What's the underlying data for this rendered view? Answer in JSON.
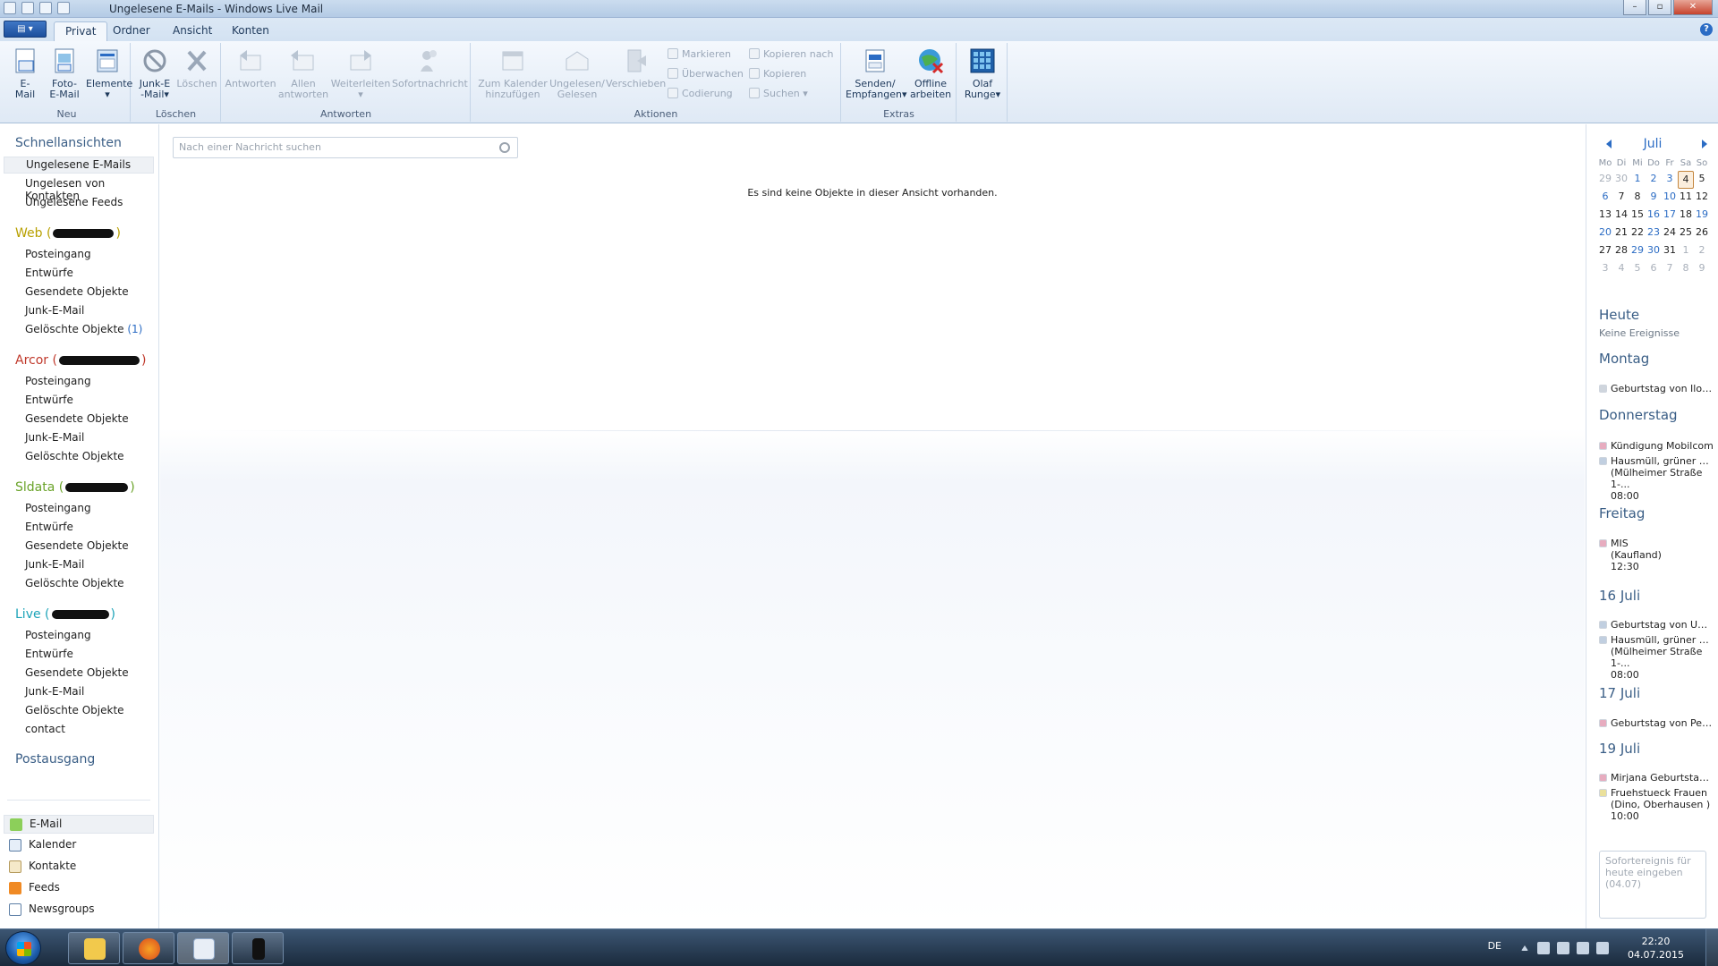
{
  "window": {
    "title": "Ungelesene E-Mails - Windows Live Mail"
  },
  "tabs": [
    "Privat",
    "Ordner",
    "Ansicht",
    "Konten"
  ],
  "ribbon": {
    "groups": {
      "neu": "Neu",
      "loeschen": "Löschen",
      "antworten": "Antworten",
      "aktionen": "Aktionen",
      "extras": "Extras"
    },
    "email": [
      "E-",
      "Mail"
    ],
    "foto_email": [
      "Foto-",
      "E-Mail"
    ],
    "elemente": "Elemente",
    "junk": [
      "Junk-E",
      "-Mail"
    ],
    "loeschen": "Löschen",
    "antworten": "Antworten",
    "allen_antworten": [
      "Allen",
      "antworten"
    ],
    "weiterleiten": "Weiterleiten",
    "sofortnachricht": "Sofortnachricht",
    "zum_kalender": [
      "Zum Kalender",
      "hinzufügen"
    ],
    "ungelesen": [
      "Ungelesen/",
      "Gelesen"
    ],
    "verschieben": "Verschieben",
    "markieren": "Markieren",
    "ueberwachen": "Überwachen",
    "codierung": "Codierung",
    "kopieren_nach": "Kopieren nach",
    "kopieren": "Kopieren",
    "suchen": "Suchen",
    "senden": [
      "Senden/",
      "Empfangen"
    ],
    "offline": [
      "Offline",
      "arbeiten"
    ],
    "user": [
      "Olaf",
      "Runge"
    ]
  },
  "sidebar": {
    "quickviews_title": "Schnellansichten",
    "quickviews": [
      "Ungelesene E-Mails",
      "Ungelesen von Kontakten",
      "Ungelesene Feeds"
    ],
    "accounts": [
      {
        "name": "Web",
        "color": "#b8a000",
        "folders": [
          "Posteingang",
          "Entwürfe",
          "Gesendete Objekte",
          "Junk-E-Mail",
          "Gelöschte Objekte"
        ],
        "deleted_count": "(1)"
      },
      {
        "name": "Arcor",
        "color": "#c0392b",
        "folders": [
          "Posteingang",
          "Entwürfe",
          "Gesendete Objekte",
          "Junk-E-Mail",
          "Gelöschte Objekte"
        ]
      },
      {
        "name": "Sldata",
        "color": "#6aa329",
        "folders": [
          "Posteingang",
          "Entwürfe",
          "Gesendete Objekte",
          "Junk-E-Mail",
          "Gelöschte Objekte"
        ]
      },
      {
        "name": "Live",
        "color": "#1ca3b8",
        "folders": [
          "Posteingang",
          "Entwürfe",
          "Gesendete Objekte",
          "Junk-E-Mail",
          "Gelöschte Objekte",
          "contact"
        ]
      }
    ],
    "outbox": "Postausgang",
    "nav": [
      "E-Mail",
      "Kalender",
      "Kontakte",
      "Feeds",
      "Newsgroups"
    ]
  },
  "main": {
    "search_placeholder": "Nach einer Nachricht suchen",
    "empty_message": "Es sind keine Objekte in dieser Ansicht vorhanden."
  },
  "calendar": {
    "month": "Juli",
    "weekdays": [
      "Mo",
      "Di",
      "Mi",
      "Do",
      "Fr",
      "Sa",
      "So"
    ],
    "weeks": [
      [
        "29",
        "30",
        "1",
        "2",
        "3",
        "4",
        "5"
      ],
      [
        "6",
        "7",
        "8",
        "9",
        "10",
        "11",
        "12"
      ],
      [
        "13",
        "14",
        "15",
        "16",
        "17",
        "18",
        "19"
      ],
      [
        "20",
        "21",
        "22",
        "23",
        "24",
        "25",
        "26"
      ],
      [
        "27",
        "28",
        "29",
        "30",
        "31",
        "1",
        "2"
      ],
      [
        "3",
        "4",
        "5",
        "6",
        "7",
        "8",
        "9"
      ]
    ],
    "today_label": "Heute",
    "no_events": "Keine Ereignisse",
    "days": [
      {
        "label": "Montag",
        "events": [
          {
            "title": "Geburtstag von Ilon...",
            "color": "#a8b4c3"
          }
        ]
      },
      {
        "label": "Donnerstag",
        "events": [
          {
            "title": "Kündigung Mobilcom",
            "color": "#d46a8c"
          },
          {
            "title": "Hausmüll, grüner De...",
            "sub": "(Mülheimer Straße 1-...",
            "time": "08:00",
            "color": "#8fa8c8"
          }
        ]
      },
      {
        "label": "Freitag",
        "events": [
          {
            "title": "MIS",
            "sub": "(Kaufland)",
            "time": "12:30",
            "color": "#d46a8c"
          }
        ]
      },
      {
        "label": "16 Juli",
        "events": [
          {
            "title": "Geburtstag von Udo...",
            "color": "#8fa8c8"
          },
          {
            "title": "Hausmüll, grüner De...",
            "sub": "(Mülheimer Straße 1-...",
            "time": "08:00",
            "color": "#8fa8c8"
          }
        ]
      },
      {
        "label": "17 Juli",
        "events": [
          {
            "title": "Geburtstag von Pete...",
            "color": "#d46a8c"
          }
        ]
      },
      {
        "label": "19 Juli",
        "events": [
          {
            "title": "Mirjana Geburtstags...",
            "color": "#d46a8c"
          },
          {
            "title": "Fruehstueck Frauen",
            "sub": "(Dino, Oberhausen )",
            "time": "10:00",
            "color": "#d9c84a"
          }
        ]
      }
    ],
    "quick_event_placeholder": "Sofortereignis für heute eingeben (04.07)"
  },
  "taskbar": {
    "language": "DE",
    "time": "22:20",
    "date": "04.07.2015"
  }
}
